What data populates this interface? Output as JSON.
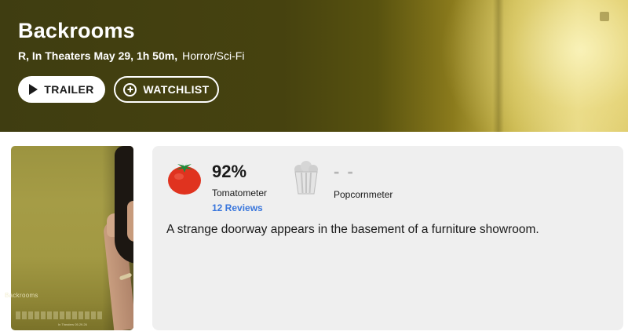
{
  "movie": {
    "title": "Backrooms",
    "rating_release_runtime": "R, In Theaters May 29, 1h 50m,",
    "genre": "Horror/Sci-Fi"
  },
  "actions": {
    "trailer_label": "TRAILER",
    "watchlist_label": "WATCHLIST"
  },
  "poster": {
    "title": "Backrooms",
    "date_text": "In Theaters 05.29.26"
  },
  "scores": {
    "tomatometer": {
      "value": "92%",
      "label": "Tomatometer",
      "reviews": "12 Reviews",
      "icon": "fresh-tomato-icon"
    },
    "popcornmeter": {
      "value": "- -",
      "label": "Popcornmeter",
      "icon": "empty-popcorn-icon"
    }
  },
  "synopsis": "A strange doorway appears in the basement of a furniture showroom.",
  "colors": {
    "hero_dark": "#3f3d11",
    "hero_light": "#e7d987",
    "tomato_red": "#e0331f",
    "link_blue": "#3976dc",
    "card_bg": "#efefef"
  }
}
